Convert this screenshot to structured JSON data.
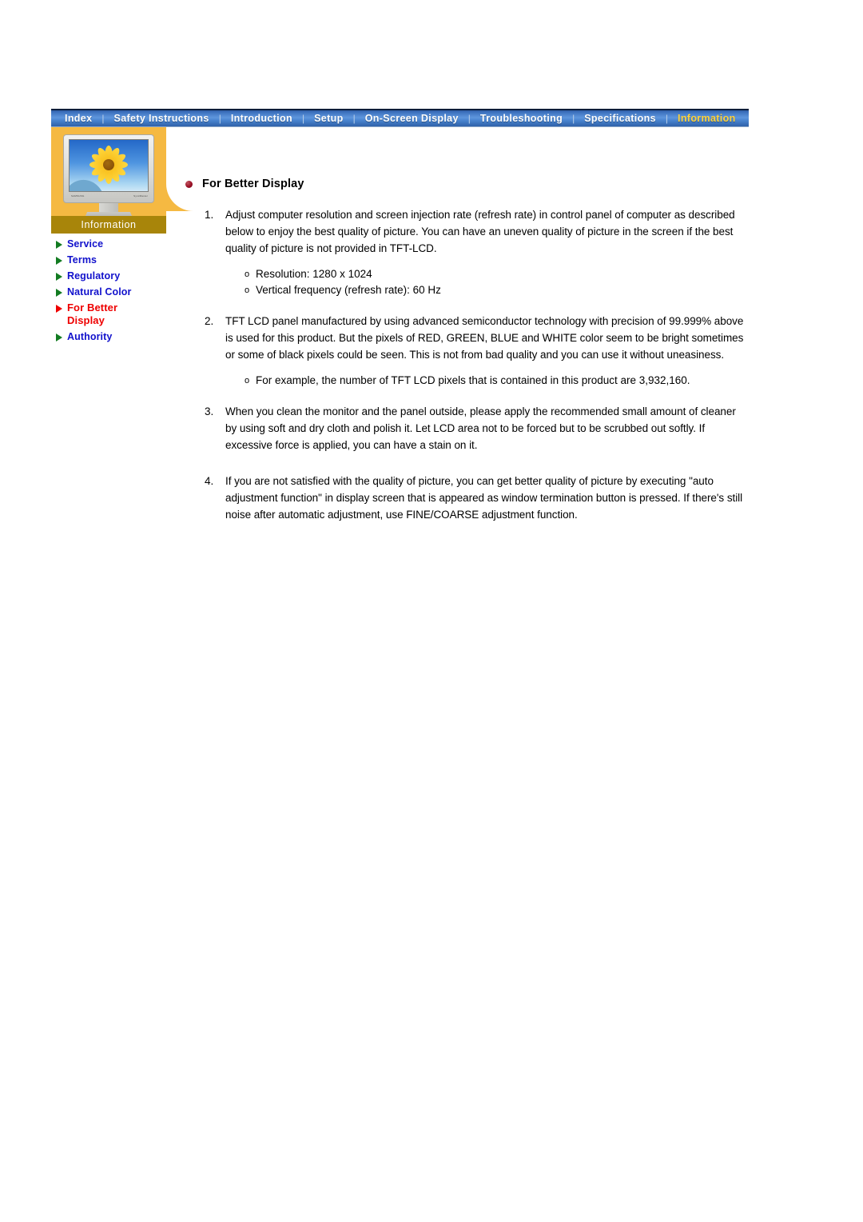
{
  "nav": {
    "items": [
      {
        "label": "Index",
        "active": false
      },
      {
        "label": "Safety Instructions",
        "active": false
      },
      {
        "label": "Introduction",
        "active": false
      },
      {
        "label": "Setup",
        "active": false
      },
      {
        "label": "On-Screen Display",
        "active": false
      },
      {
        "label": "Troubleshooting",
        "active": false
      },
      {
        "label": "Specifications",
        "active": false
      },
      {
        "label": "Information",
        "active": true
      }
    ],
    "separator": "|",
    "colors": {
      "bar_start": "#2f5fa8",
      "bar_mid": "#5e96dd",
      "text": "#ffffff",
      "active_text": "#ffd23b"
    }
  },
  "sidebar": {
    "title": "Information",
    "panel_color": "#f5b942",
    "title_bar_color": "#a8850a",
    "monitor": {
      "brand_label": "SAMSUNG",
      "model_label": "SyncMaster",
      "icon": "lcd-monitor-sunflower"
    },
    "items": [
      {
        "label": "Service",
        "current": false
      },
      {
        "label": "Terms",
        "current": false
      },
      {
        "label": "Regulatory",
        "current": false
      },
      {
        "label": "Natural Color",
        "current": false
      },
      {
        "label": "For Better Display",
        "current": true
      },
      {
        "label": "Authority",
        "current": false
      }
    ],
    "colors": {
      "link": "#1111cc",
      "current": "#ee0000",
      "arrow": "#127b21",
      "arrow_current": "#ee0000"
    }
  },
  "content": {
    "heading": "For Better Display",
    "heading_bullet_color": "#9b1026",
    "items": [
      {
        "number": "1.",
        "text": "Adjust computer resolution and screen injection rate (refresh rate) in control panel of computer as described below to enjoy the best quality of picture. You can have an uneven quality of picture in the screen if the best quality of picture is not provided in TFT-LCD.",
        "sub": [
          {
            "marker": "o",
            "text": "Resolution: 1280 x 1024"
          },
          {
            "marker": "o",
            "text": "Vertical frequency (refresh rate): 60 Hz"
          }
        ]
      },
      {
        "number": "2.",
        "text": "TFT LCD panel manufactured by using advanced semiconductor technology with precision of 99.999% above is used for this product. But the pixels of RED, GREEN, BLUE and WHITE color seem to be bright sometimes or some of black pixels could be seen. This is not from bad quality and you can use it without uneasiness.",
        "sub": [
          {
            "marker": "o",
            "text": "For example, the number of TFT LCD pixels that is contained in this product are 3,932,160."
          }
        ]
      },
      {
        "number": "3.",
        "text": "When you clean the monitor and the panel outside, please apply the recommended small amount of cleaner by using soft and dry cloth and polish it. Let LCD area not to be forced but to be scrubbed out softly. If excessive force is applied, you can have a stain on it.",
        "sub": []
      },
      {
        "number": "4.",
        "text": "If you are not satisfied with the quality of picture, you can get better quality of picture by executing \"auto adjustment function\" in display screen that is appeared as window termination button is pressed. If there's still noise after automatic adjustment, use FINE/COARSE adjustment function.",
        "sub": []
      }
    ]
  }
}
